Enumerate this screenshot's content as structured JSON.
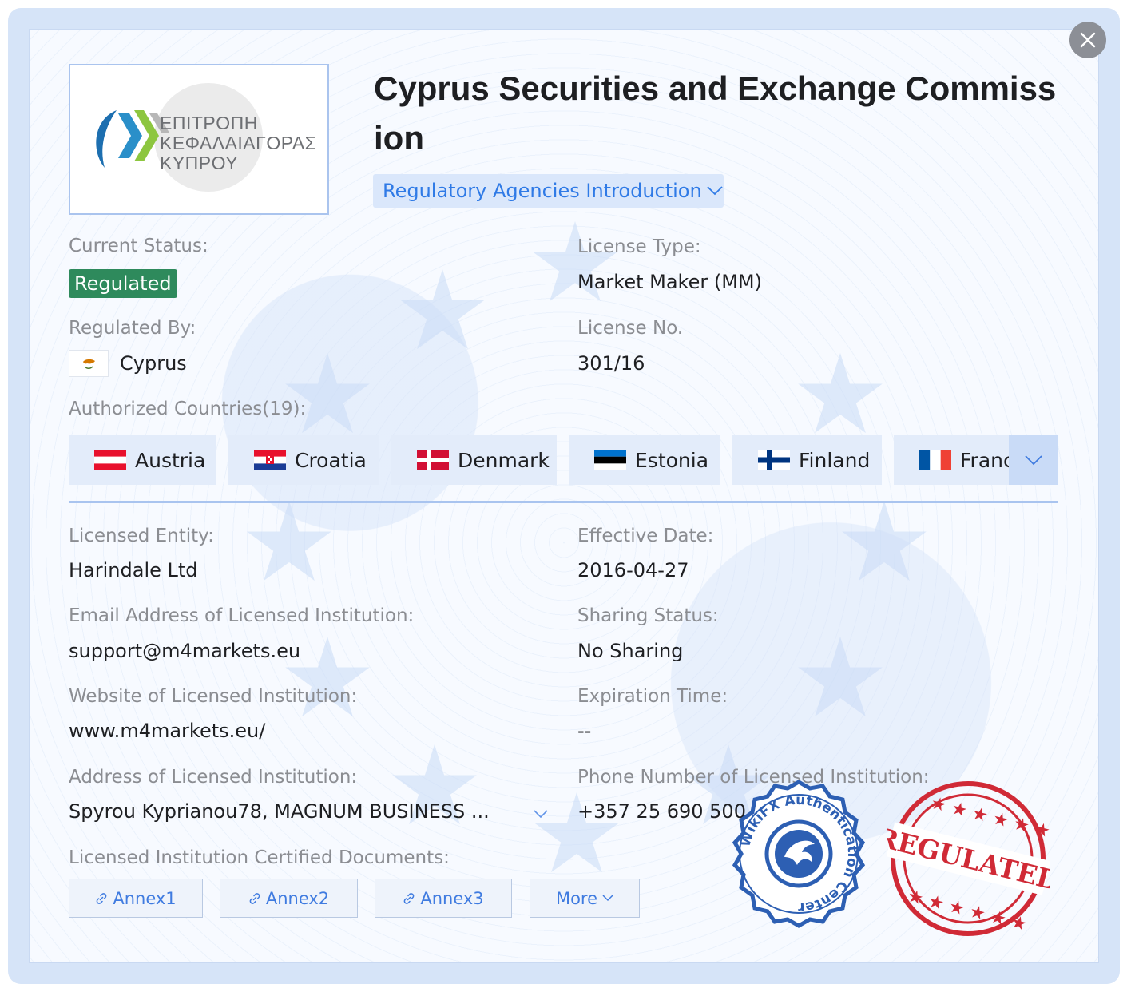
{
  "regulator": {
    "title": "Cyprus Securities and Exchange Commission",
    "logo_lines": [
      "ΕΠΙΤΡΟΠΗ",
      "ΚΕΦΑΛΑΙΑΓΟΡΑΣ",
      "ΚΥΠΡΟΥ"
    ],
    "intro_button": "Regulatory Agencies Introduction"
  },
  "status": {
    "current_status_label": "Current Status:",
    "current_status_value": "Regulated",
    "license_type_label": "License Type:",
    "license_type_value": "Market Maker (MM)",
    "regulated_by_label": "Regulated By:",
    "regulated_by_value": "Cyprus",
    "license_no_label": "License No.",
    "license_no_value": "301/16",
    "authorized_label": "Authorized Countries(19):"
  },
  "countries": [
    {
      "name": "Austria",
      "flag": "austria-flag"
    },
    {
      "name": "Croatia",
      "flag": "croatia-flag"
    },
    {
      "name": "Denmark",
      "flag": "denmark-flag"
    },
    {
      "name": "Estonia",
      "flag": "estonia-flag"
    },
    {
      "name": "Finland",
      "flag": "finland-flag"
    },
    {
      "name": "France",
      "flag": "france-flag"
    }
  ],
  "details": {
    "entity_label": "Licensed Entity:",
    "entity_value": "Harindale Ltd",
    "effective_label": "Effective Date:",
    "effective_value": "2016-04-27",
    "email_label": "Email Address of Licensed Institution:",
    "email_value": "support@m4markets.eu",
    "sharing_label": "Sharing Status:",
    "sharing_value": "No Sharing",
    "website_label": "Website of Licensed Institution:",
    "website_value": "www.m4markets.eu/",
    "expiration_label": "Expiration Time:",
    "expiration_value": "--",
    "address_label": "Address of Licensed Institution:",
    "address_value": "Spyrou Kyprianou78, MAGNUM BUSINESS ...",
    "phone_label": "Phone Number of Licensed Institution:",
    "phone_value": "+357 25 690 500",
    "docs_label": "Licensed Institution Certified Documents:"
  },
  "documents": [
    "Annex1",
    "Annex2",
    "Annex3"
  ],
  "more_label": "More",
  "seals": {
    "blue_text": "WikiFX Authentication Center",
    "red_text": "REGULATED"
  },
  "colors": {
    "accent": "#2f7ae6",
    "regulated_green": "#2e8a5c",
    "seal_blue": "#2d5fb3",
    "seal_red": "#d02a36"
  }
}
